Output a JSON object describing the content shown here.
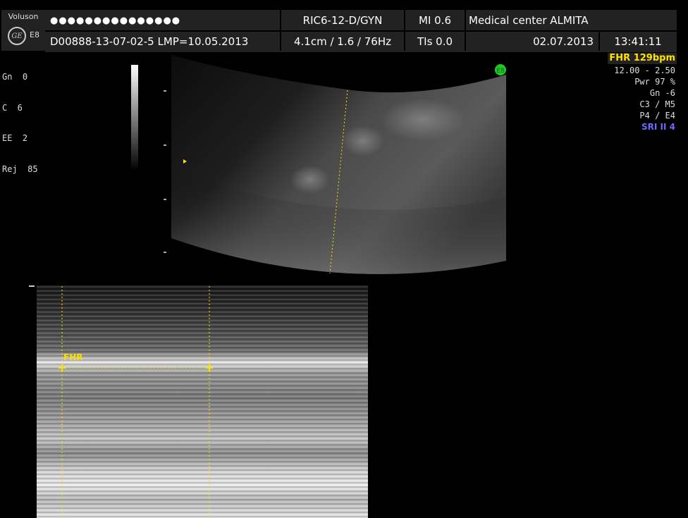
{
  "header": {
    "brand": "Voluson",
    "logo_text": "GE",
    "model": "E8",
    "patient_name": "●●●●●●●●●●●●●●●",
    "patient_id": "D00888-13-07-02-5",
    "lmp": "LMP=10.05.2013",
    "probe": "RIC6-12-D/GYN",
    "depth_info": "4.1cm / 1.6 / 76Hz",
    "mi": "MI  0.6",
    "tis": "TIs  0.0",
    "institution": "Medical center ALMITA",
    "date": "02.07.2013",
    "time": "13:41:11"
  },
  "left_params": [
    {
      "label": "Gn  0"
    },
    {
      "label": "C  6"
    },
    {
      "label": "EE  2"
    },
    {
      "label": "Rej  85"
    }
  ],
  "right_params": {
    "fhr": "FHR 129bpm",
    "freq": "12.00 - 2.50",
    "pwr": "Pwr  97 %",
    "gn": "Gn  -6",
    "cm": "C3 / M5",
    "pe": "P4 / E4",
    "sri": "SRI II 4"
  },
  "probe_marker": "E8",
  "mmode": {
    "fhr_label": "FHR"
  },
  "colors": {
    "header_bg": "#222222",
    "fhr_yellow": "#ffe000",
    "sri_blue": "#6a6aff",
    "marker_green": "#1ec81e"
  }
}
